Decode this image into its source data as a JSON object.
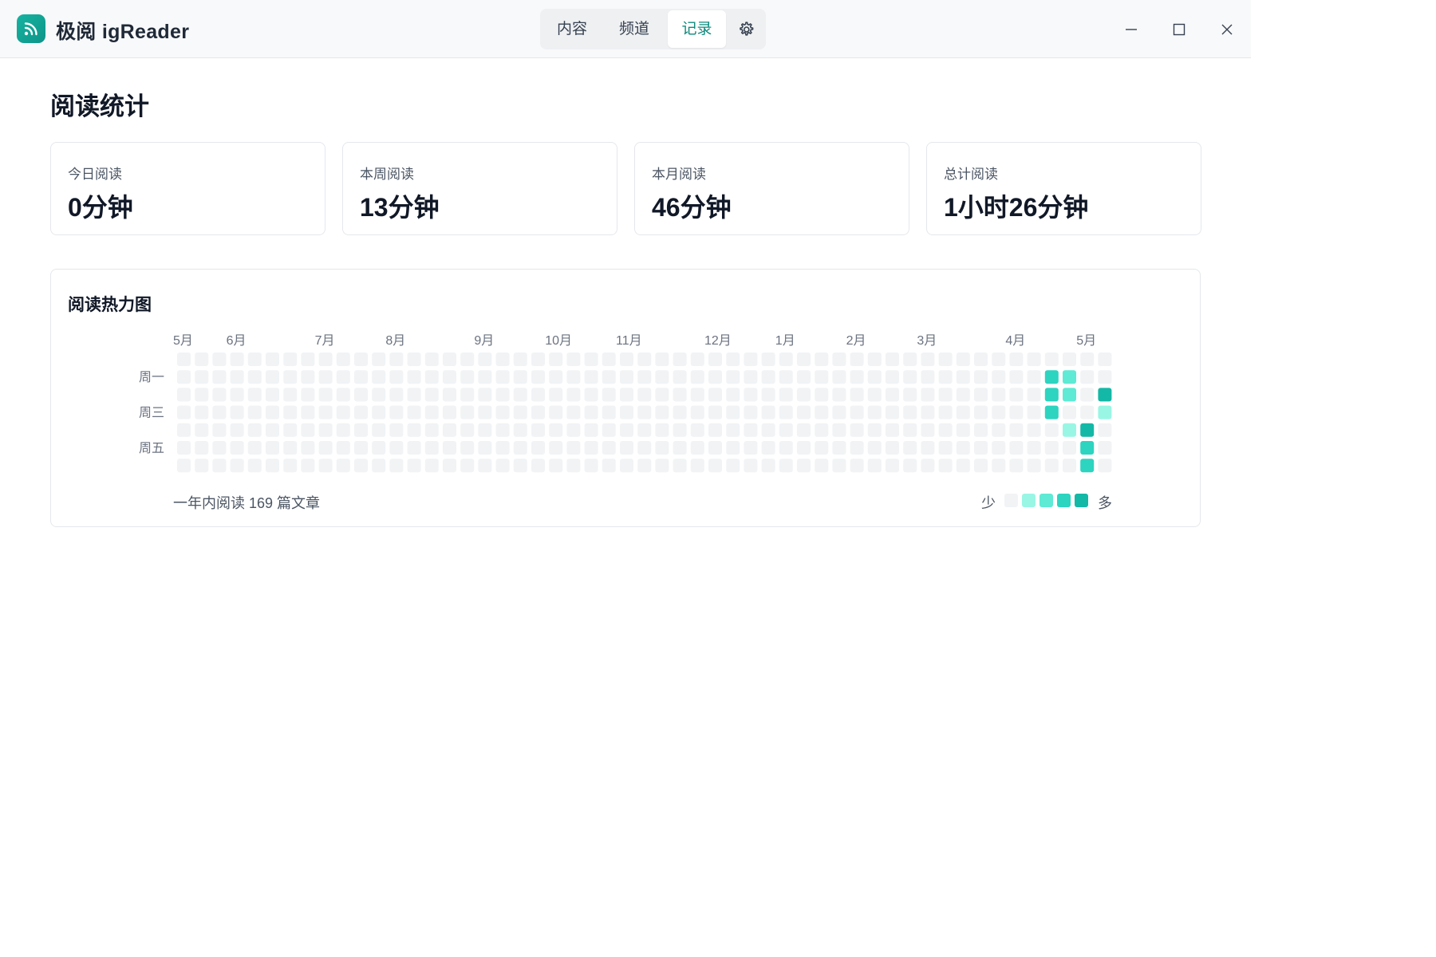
{
  "app": {
    "title": "极阅 igReader",
    "icon": "rss-icon"
  },
  "nav": {
    "tabs": [
      {
        "label": "内容",
        "active": false
      },
      {
        "label": "频道",
        "active": false
      },
      {
        "label": "记录",
        "active": true
      }
    ],
    "settings_icon": "gear-icon"
  },
  "window_controls": [
    "minimize-icon",
    "maximize-icon",
    "close-icon"
  ],
  "page": {
    "title": "阅读统计"
  },
  "stats": [
    {
      "label": "今日阅读",
      "value": "0分钟"
    },
    {
      "label": "本周阅读",
      "value": "13分钟"
    },
    {
      "label": "本月阅读",
      "value": "46分钟"
    },
    {
      "label": "总计阅读",
      "value": "1小时26分钟"
    }
  ],
  "heatmap": {
    "title": "阅读热力图",
    "months": [
      {
        "label": "5月",
        "week": 0
      },
      {
        "label": "6月",
        "week": 3
      },
      {
        "label": "7月",
        "week": 8
      },
      {
        "label": "8月",
        "week": 12
      },
      {
        "label": "9月",
        "week": 17
      },
      {
        "label": "10月",
        "week": 21
      },
      {
        "label": "11月",
        "week": 25
      },
      {
        "label": "12月",
        "week": 30
      },
      {
        "label": "1月",
        "week": 34
      },
      {
        "label": "2月",
        "week": 38
      },
      {
        "label": "3月",
        "week": 42
      },
      {
        "label": "4月",
        "week": 47
      },
      {
        "label": "5月",
        "week": 51
      }
    ],
    "day_labels": [
      {
        "label": "周一",
        "row": 1
      },
      {
        "label": "周三",
        "row": 3
      },
      {
        "label": "周五",
        "row": 5
      }
    ],
    "weeks": 53,
    "days": 7,
    "colors": [
      "#f1f3f5",
      "#99f6e4",
      "#5eead4",
      "#2dd4bf",
      "#14b8a6"
    ],
    "active_cells": [
      {
        "week": 49,
        "day": 1,
        "level": 3
      },
      {
        "week": 49,
        "day": 2,
        "level": 3
      },
      {
        "week": 49,
        "day": 3,
        "level": 3
      },
      {
        "week": 50,
        "day": 1,
        "level": 2
      },
      {
        "week": 50,
        "day": 2,
        "level": 2
      },
      {
        "week": 50,
        "day": 4,
        "level": 1
      },
      {
        "week": 51,
        "day": 4,
        "level": 4
      },
      {
        "week": 51,
        "day": 5,
        "level": 3
      },
      {
        "week": 51,
        "day": 6,
        "level": 3
      },
      {
        "week": 52,
        "day": 2,
        "level": 4
      },
      {
        "week": 52,
        "day": 3,
        "level": 1
      }
    ],
    "summary": "一年内阅读 169 篇文章",
    "legend_less": "少",
    "legend_more": "多"
  }
}
